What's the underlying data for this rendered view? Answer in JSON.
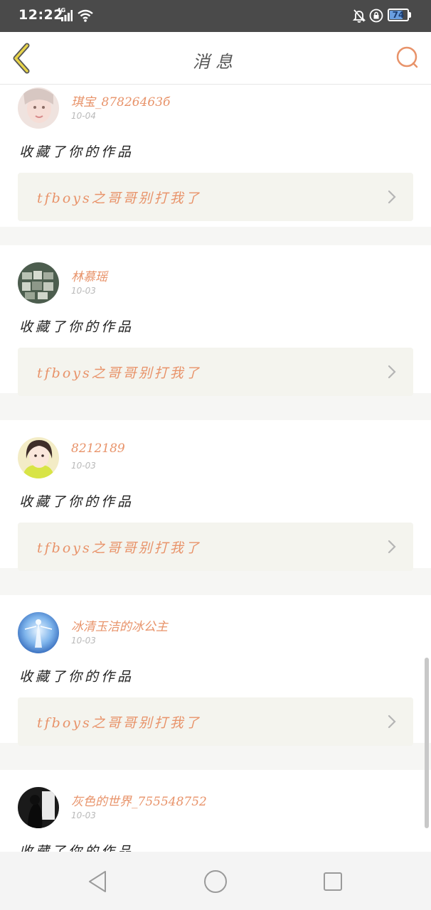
{
  "status_bar": {
    "time": "12:22",
    "network": "4G",
    "battery": "74",
    "battery_level": 0.74,
    "icons": [
      "signal-icon",
      "wifi-icon",
      "bell-muted-icon",
      "lock-icon",
      "battery-icon"
    ]
  },
  "header": {
    "title": "消息",
    "back_icon": "chevron-left-icon",
    "search_icon": "search-icon",
    "accent_color": "#e8936a",
    "back_color": "#e8d44a"
  },
  "messages": [
    {
      "username": "琪宝_87826463б",
      "date": "10-04",
      "action": "收藏了你的作品",
      "work_title": "tfboys之哥哥别打我了"
    },
    {
      "username": "林慕瑶",
      "date": "10-03",
      "action": "收藏了你的作品",
      "work_title": "tfboys之哥哥别打我了"
    },
    {
      "username": "8212189",
      "date": "10-03",
      "action": "收藏了你的作品",
      "work_title": "tfboys之哥哥别打我了"
    },
    {
      "username": "冰清玉洁的冰公主",
      "date": "10-03",
      "action": "收藏了你的作品",
      "work_title": "tfboys之哥哥别打我了"
    },
    {
      "username": "灰色的世界_755548752",
      "date": "10-03",
      "action": "收藏了你的作品",
      "work_title": ""
    }
  ],
  "nav_bar": {
    "buttons": [
      "back-triangle-icon",
      "home-circle-icon",
      "recents-square-icon"
    ]
  }
}
